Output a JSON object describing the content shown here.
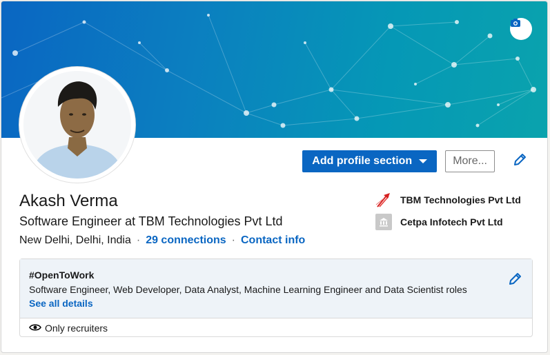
{
  "profile": {
    "name": "Akash Verma",
    "headline": "Software Engineer at TBM Technologies Pvt Ltd",
    "location": "New Delhi, Delhi, India",
    "connections": "29 connections",
    "contact_info": "Contact info",
    "separator": "·"
  },
  "actions": {
    "add_section": "Add profile section",
    "more": "More...",
    "edit_icon": "pencil-icon",
    "camera_icon": "camera-icon"
  },
  "companies": [
    {
      "name": "TBM Technologies Pvt Ltd",
      "logo": "tbm-logo"
    },
    {
      "name": "Cetpa Infotech Pvt Ltd",
      "logo": "building-icon"
    }
  ],
  "open_to_work": {
    "title": "#OpenToWork",
    "roles": "Software Engineer, Web Developer, Data Analyst, Machine Learning Engineer and Data Scientist roles",
    "see_all": "See all details",
    "visibility": "Only recruiters",
    "visibility_icon": "eye-icon"
  },
  "colors": {
    "brand_blue": "#0a66c2",
    "banner_start": "#0a66c2",
    "banner_end": "#0aa3ad",
    "card_bg": "#eef3f8"
  }
}
